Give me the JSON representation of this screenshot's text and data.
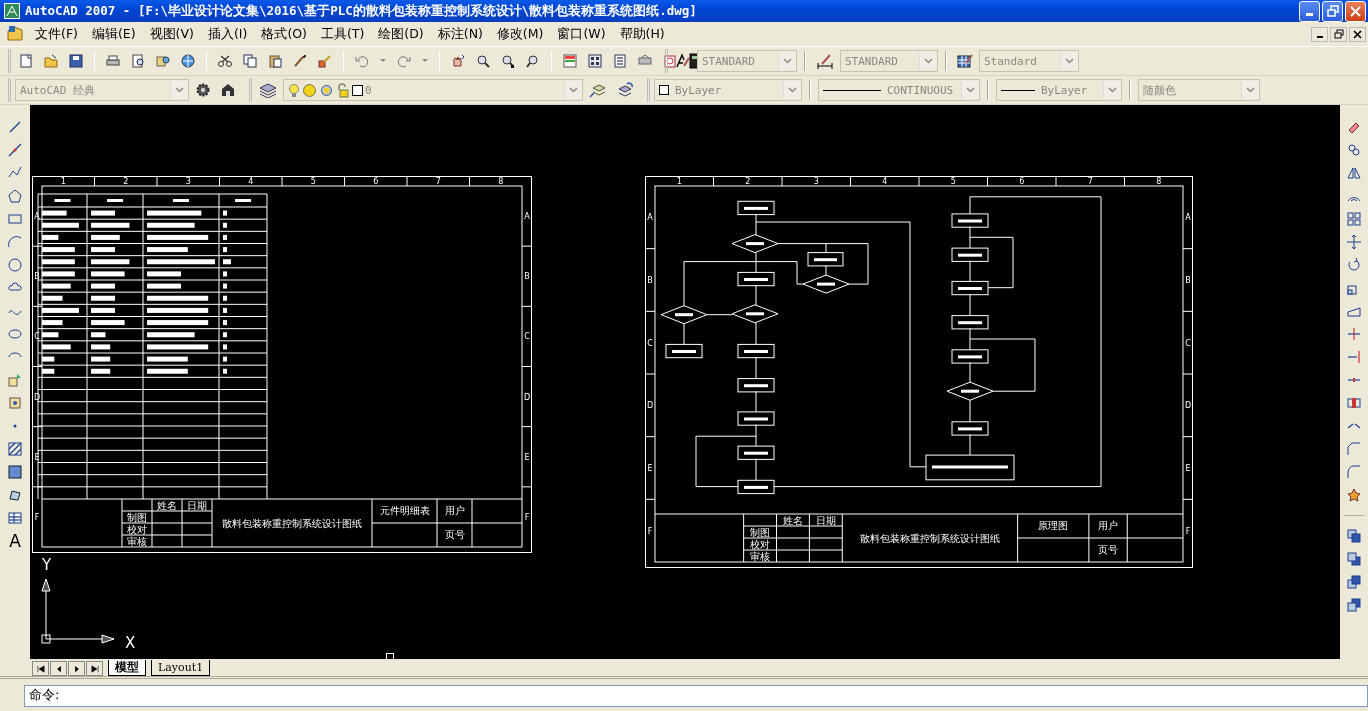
{
  "window": {
    "title": "AutoCAD 2007 - [F:\\毕业设计论文集\\2016\\基于PLC的散料包装称重控制系统设计\\散料包装称重系统图纸.dwg]"
  },
  "menu": [
    "文件(F)",
    "编辑(E)",
    "视图(V)",
    "插入(I)",
    "格式(O)",
    "工具(T)",
    "绘图(D)",
    "标注(N)",
    "修改(M)",
    "窗口(W)",
    "帮助(H)"
  ],
  "styles_toolbar": {
    "text_style": "STANDARD",
    "dim_style": "STANDARD",
    "table_style": "Standard"
  },
  "workspace": "AutoCAD 经典",
  "layer": "0",
  "properties": {
    "color_control": "ByLayer",
    "linetype": "CONTINUOUS",
    "lineweight": "ByLayer",
    "plot_style": "随颜色"
  },
  "draw_toolbar_text_tool": "A",
  "drawings": [
    {
      "kind": "parts_list",
      "column_labels": [
        "1",
        "2",
        "3",
        "4",
        "5",
        "6",
        "7",
        "8"
      ],
      "row_labels_left": [
        "A",
        "B",
        "C",
        "D",
        "E",
        "F"
      ],
      "row_labels_right": [
        "A",
        "B",
        "C",
        "D",
        "E",
        "F"
      ],
      "title_block": {
        "sign_header": [
          "姓名",
          "日期"
        ],
        "sign_rows": [
          "制图",
          "校对",
          "审核"
        ],
        "title": "散料包装称重控制系统设计图纸",
        "sheet_name": "元件明细表",
        "fields": [
          "用户",
          "页号"
        ]
      }
    },
    {
      "kind": "flowchart",
      "column_labels": [
        "1",
        "2",
        "3",
        "4",
        "5",
        "6",
        "7",
        "8"
      ],
      "row_labels_left": [
        "A",
        "B",
        "C",
        "D",
        "E",
        "F"
      ],
      "row_labels_right": [
        "A",
        "B",
        "C",
        "D",
        "E",
        "F"
      ],
      "title_block": {
        "sign_header": [
          "姓名",
          "日期"
        ],
        "sign_rows": [
          "制图",
          "校对",
          "审核"
        ],
        "title": "散料包装称重控制系统设计图纸",
        "sheet_name": "原理图",
        "fields": [
          "用户",
          "页号"
        ]
      }
    }
  ],
  "ucs": {
    "y": "Y",
    "x": "X"
  },
  "layout_tabs": [
    {
      "label": "模型",
      "selected": true
    },
    {
      "label": "Layout1",
      "selected": false
    }
  ],
  "command_prompt": "命令:"
}
